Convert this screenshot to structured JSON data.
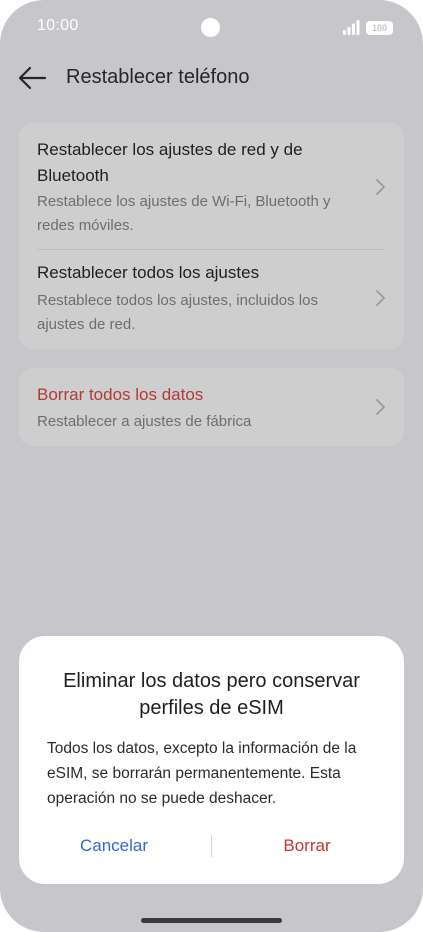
{
  "status_bar": {
    "time": "10:00",
    "battery": "100",
    "icons": [
      "signal-icon",
      "battery-icon"
    ]
  },
  "header": {
    "title": "Restablecer teléfono",
    "back_icon": "arrow-left-icon"
  },
  "reset_options": [
    {
      "title": "Restablecer los ajustes de red y de Bluetooth",
      "subtitle": "Restablece los ajustes de Wi-Fi, Bluetooth y redes móviles."
    },
    {
      "title": "Restablecer todos los ajustes",
      "subtitle": "Restablece todos los ajustes, incluidos los ajustes de red."
    }
  ],
  "erase_option": {
    "title": "Borrar todos los datos",
    "subtitle": "Restablecer a ajustes de fábrica"
  },
  "dialog": {
    "title": "Eliminar los datos pero conservar perfiles de eSIM",
    "body": "Todos los datos, excepto la información de la eSIM, se borrarán permanentemente. Esta operación no se puede deshacer.",
    "cancel_label": "Cancelar",
    "confirm_label": "Borrar"
  },
  "colors": {
    "background_dimmed": "#c7c7cb",
    "card": "#cecece",
    "danger": "#b33a36",
    "accent_blue": "#2f6bd1",
    "confirm_red": "#c6352e"
  }
}
